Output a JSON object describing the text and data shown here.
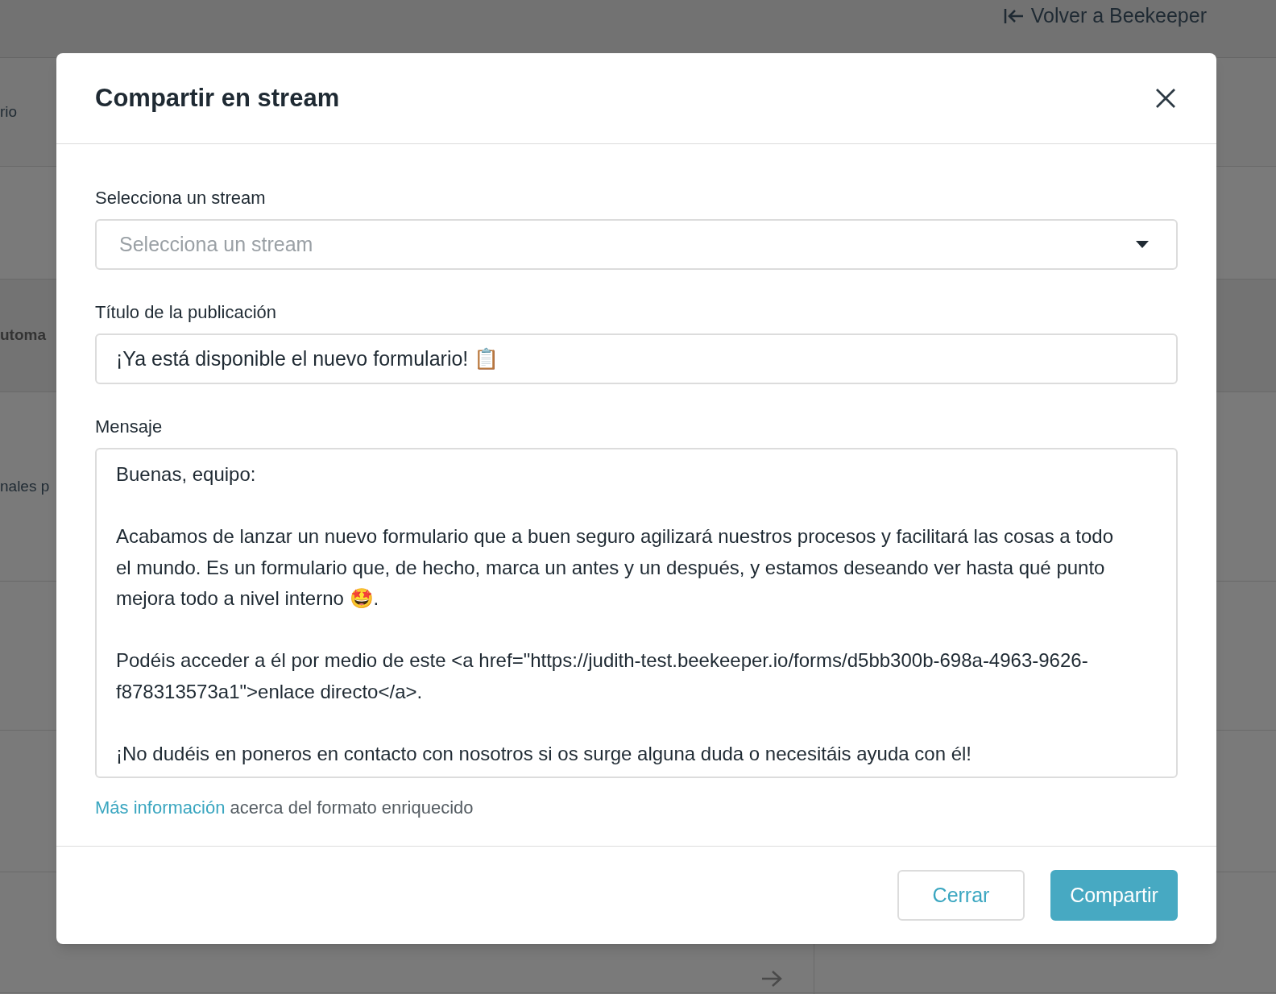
{
  "background": {
    "back_link": "Volver a Beekeeper",
    "side_texts": [
      {
        "text": "rio",
        "bold": false
      },
      {
        "text": "utoma",
        "bold": true
      },
      {
        "text": "nales p",
        "bold": false
      }
    ]
  },
  "dialog": {
    "title": "Compartir en stream",
    "stream_field": {
      "label": "Selecciona un stream",
      "placeholder": "Selecciona un stream"
    },
    "title_field": {
      "label": "Título de la publicación",
      "value": "¡Ya está disponible el nuevo formulario! 📋"
    },
    "message_field": {
      "label": "Mensaje",
      "value": "Buenas, equipo:\n\nAcabamos de lanzar un nuevo formulario que a buen seguro agilizará nuestros procesos y facilitará las cosas a todo el mundo. Es un formulario que, de hecho, marca un antes y un después, y estamos deseando ver hasta qué punto mejora todo a nivel interno 🤩.\n\nPodéis acceder a él por medio de este <a href=\"https://judith-test.beekeeper.io/forms/d5bb300b-698a-4963-9626-f878313573a1\">enlace directo</a>.\n\n¡No dudéis en poneros en contacto con nosotros si os surge alguna duda o necesitáis ayuda con él!"
    },
    "help": {
      "link": "Más información",
      "text": "acerca del formato enriquecido"
    },
    "buttons": [
      {
        "label": "Cerrar",
        "kind": "secondary"
      },
      {
        "label": "Compartir",
        "kind": "primary"
      }
    ]
  }
}
